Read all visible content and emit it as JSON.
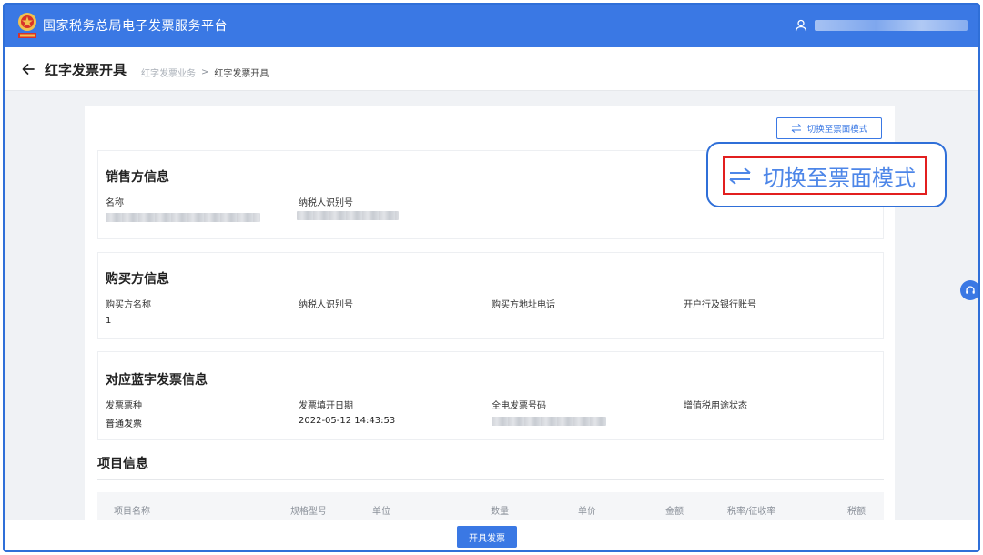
{
  "header": {
    "platform_title": "国家税务总局电子发票服务平台",
    "emblem_icon": "tax-emblem-icon",
    "user_icon": "user-icon"
  },
  "subheader": {
    "page_title": "红字发票开具",
    "breadcrumb": [
      "红字发票业务",
      "红字发票开具"
    ],
    "breadcrumb_separator": ">"
  },
  "actions": {
    "switch_mode_label": "切换至票面模式",
    "issue_label": "开具发票"
  },
  "seller": {
    "title": "销售方信息",
    "name_label": "名称",
    "tax_id_label": "纳税人识别号"
  },
  "buyer": {
    "title": "购买方信息",
    "name_label": "购买方名称",
    "name_value": "1",
    "tax_id_label": "纳税人识别号",
    "address_label": "购买方地址电话",
    "bank_label": "开户行及银行账号"
  },
  "blue_invoice": {
    "title": "对应蓝字发票信息",
    "type_label": "发票票种",
    "type_value": "普通发票",
    "date_label": "发票填开日期",
    "date_value": "2022-05-12 14:43:53",
    "number_label": "全电发票号码",
    "vat_label": "增值税用途状态"
  },
  "items": {
    "title": "项目信息",
    "columns": [
      "项目名称",
      "规格型号",
      "单位",
      "数量",
      "单价",
      "金额",
      "税率/征收率",
      "税额"
    ]
  },
  "colors": {
    "primary": "#3a78e4",
    "highlight_red": "#e21f1f"
  }
}
